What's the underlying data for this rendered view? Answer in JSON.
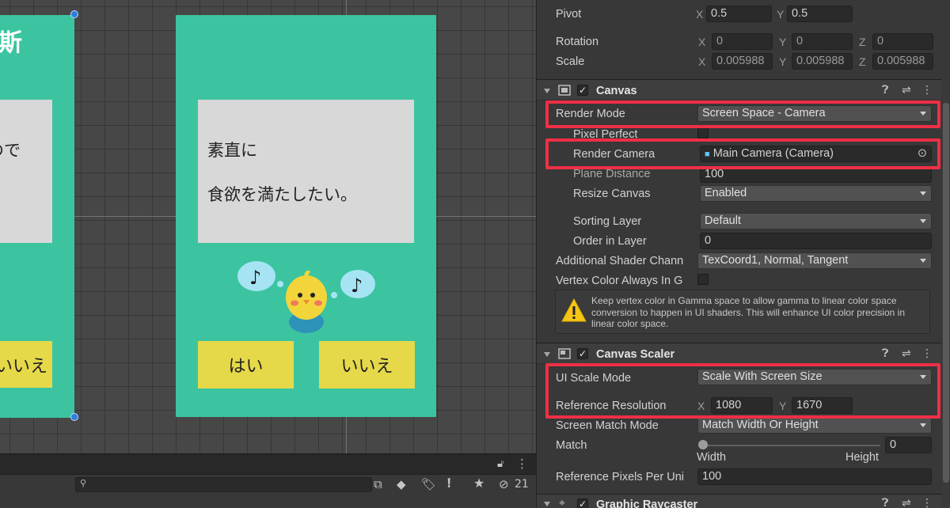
{
  "scene": {
    "left_card": {
      "logo_fragment": "斯",
      "question_fragment": "ので",
      "dots": "。",
      "no_button": "いいえ"
    },
    "right_card": {
      "question_line1": "素直に",
      "question_line2": "食欲を満たしたい。",
      "yes_button": "はい",
      "no_button": "いいえ"
    }
  },
  "scene_toolbar": {
    "search_placeholder": "",
    "hidden_count": "21"
  },
  "inspector": {
    "transform": {
      "pivot_label": "Pivot",
      "pivot_x": "0.5",
      "pivot_y": "0.5",
      "rotation_label": "Rotation",
      "rotation_x": "0",
      "rotation_y": "0",
      "rotation_z": "0",
      "scale_label": "Scale",
      "scale_x": "0.005988",
      "scale_y": "0.005988",
      "scale_z": "0.005988"
    },
    "axis": {
      "x": "X",
      "y": "Y",
      "z": "Z"
    },
    "canvas": {
      "title": "Canvas",
      "render_mode_label": "Render Mode",
      "render_mode_value": "Screen Space - Camera",
      "pixel_perfect_label": "Pixel Perfect",
      "render_camera_label": "Render Camera",
      "render_camera_value": "Main Camera (Camera)",
      "plane_distance_label": "Plane Distance",
      "plane_distance_value": "100",
      "resize_canvas_label": "Resize Canvas",
      "resize_canvas_value": "Enabled",
      "sorting_layer_label": "Sorting Layer",
      "sorting_layer_value": "Default",
      "order_in_layer_label": "Order in Layer",
      "order_in_layer_value": "0",
      "additional_shader_label": "Additional Shader Chann",
      "additional_shader_value": "TexCoord1, Normal, Tangent",
      "vertex_color_label": "Vertex Color Always In G",
      "warning_text": "Keep vertex color in Gamma space to allow gamma to linear color space conversion to happen in UI shaders. This will enhance UI color precision in linear color space."
    },
    "canvas_scaler": {
      "title": "Canvas Scaler",
      "ui_scale_mode_label": "UI Scale Mode",
      "ui_scale_mode_value": "Scale With Screen Size",
      "reference_resolution_label": "Reference Resolution",
      "reference_resolution_x": "1080",
      "reference_resolution_y": "1670",
      "screen_match_mode_label": "Screen Match Mode",
      "screen_match_mode_value": "Match Width Or Height",
      "match_label": "Match",
      "match_value": "0",
      "match_left": "Width",
      "match_right": "Height",
      "reference_ppu_label": "Reference Pixels Per Uni",
      "reference_ppu_value": "100"
    },
    "graphic_raycaster": {
      "title": "Graphic Raycaster"
    }
  },
  "colors": {
    "canvas_green": "#3cc4a0",
    "question_box": "#d8d8d8",
    "answer_button": "#e5d94a",
    "highlight_red": "#ee2f46",
    "warning_yellow": "#f5c518"
  }
}
